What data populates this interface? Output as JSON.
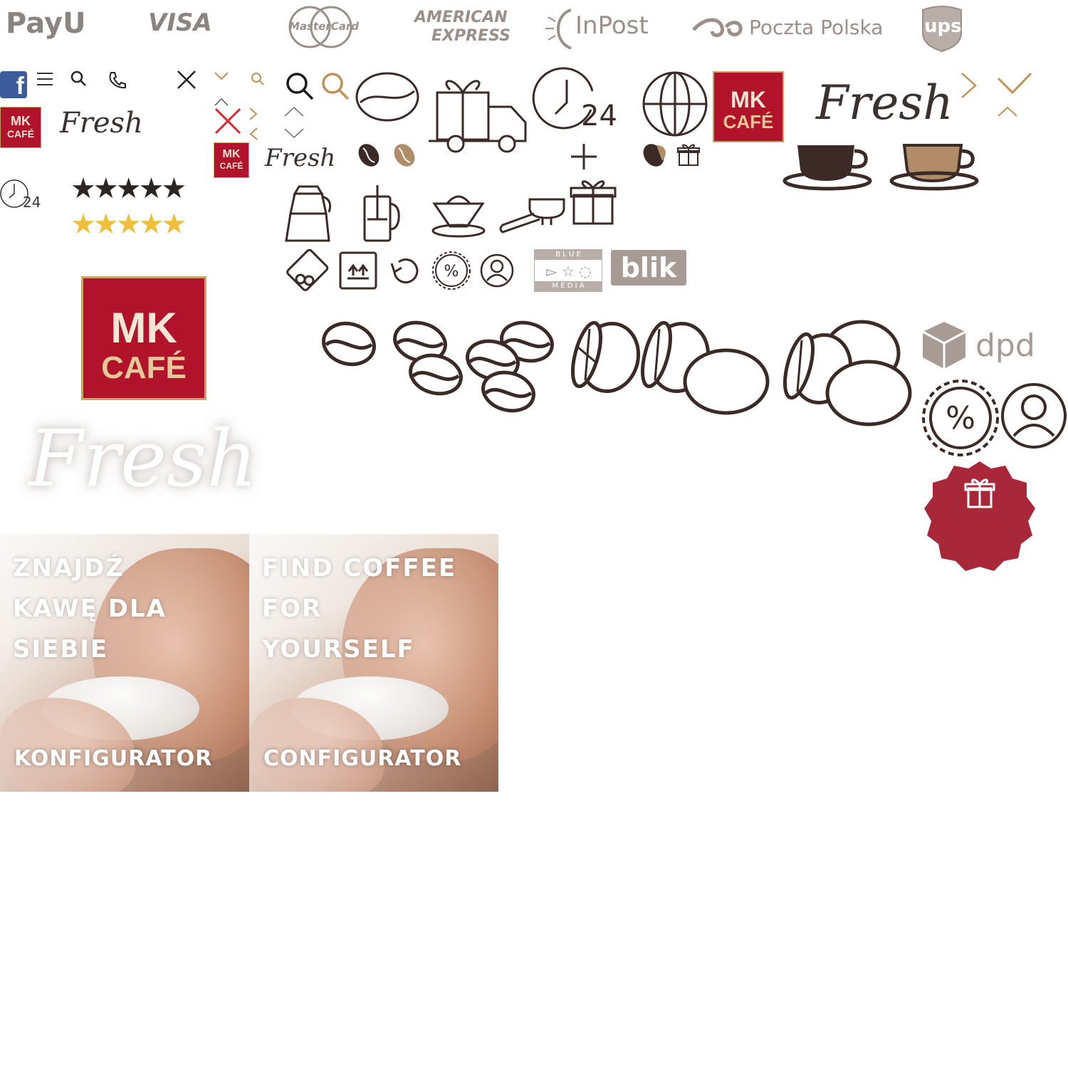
{
  "payment_logos": {
    "payu": "PayU",
    "visa": "VISA",
    "mastercard": "MasterCard",
    "amex_line1": "AMERICAN",
    "amex_line2": "EXPRESS",
    "inpost": "InPost",
    "poczta_polska": "Poczta Polska",
    "ups": "ups",
    "dpd": "dpd",
    "blik": "blik",
    "blue_media_top": "B L U E",
    "blue_media_bottom": "M E D I A"
  },
  "brand": {
    "mk_line1": "MK",
    "mk_line2": "CAFÉ",
    "fresh": "Fresh"
  },
  "clock_label": "24",
  "ratings": {
    "dark_stars": "★★★★★",
    "gold_stars": "★★★★★"
  },
  "promo_panels": [
    {
      "headline": [
        "ZNAJDŹ",
        "KAWĘ DLA",
        "SIEBIE"
      ],
      "button": "KONFIGURATOR"
    },
    {
      "headline": [
        "FIND COFFEE",
        "FOR",
        "YOURSELF"
      ],
      "button": "CONFIGURATOR"
    }
  ],
  "colors": {
    "icon_dark": "#3b2a26",
    "icon_gold": "#c09257",
    "logo_grey": "#9b8f88",
    "brand_red": "#b1142a",
    "badge_red": "#a8283a",
    "star_gold": "#efbe3a"
  }
}
